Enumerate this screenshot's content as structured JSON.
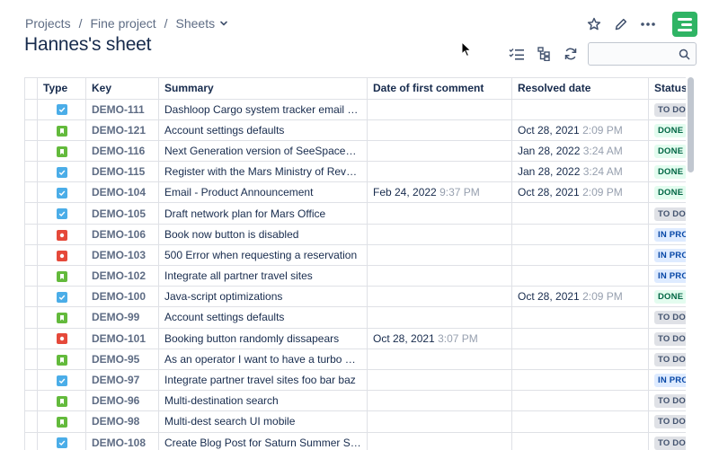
{
  "breadcrumb": {
    "items": [
      "Projects",
      "Fine project",
      "Sheets"
    ],
    "separator": "/"
  },
  "page": {
    "title": "Hannes's sheet"
  },
  "top_actions": [
    "star-icon",
    "pencil-icon",
    "more-icon",
    "app-logo"
  ],
  "toolbar": [
    "checklist-icon",
    "hierarchy-icon",
    "refresh-icon"
  ],
  "search": {
    "value": "",
    "placeholder": ""
  },
  "table": {
    "columns": [
      "Type",
      "Key",
      "Summary",
      "Date of first comment",
      "Resolved date",
      "Status"
    ],
    "rows": [
      {
        "type": "task",
        "key": "DEMO-111",
        "summary": "Dashloop Cargo system tracker email setup",
        "comment_date": "",
        "comment_time": "",
        "resolved_date": "",
        "resolved_time": "",
        "status": "TO DO"
      },
      {
        "type": "story",
        "key": "DEMO-121",
        "summary": "Account settings defaults",
        "comment_date": "",
        "comment_time": "",
        "resolved_date": "Oct 28, 2021",
        "resolved_time": "2:09 PM",
        "status": "DONE"
      },
      {
        "type": "story",
        "key": "DEMO-116",
        "summary": "Next Generation version of SeeSpaceEZ t…",
        "comment_date": "",
        "comment_time": "",
        "resolved_date": "Jan 28, 2022",
        "resolved_time": "3:24 AM",
        "status": "DONE"
      },
      {
        "type": "task",
        "key": "DEMO-115",
        "summary": "Register with the Mars Ministry of Revenue",
        "comment_date": "",
        "comment_time": "",
        "resolved_date": "Jan 28, 2022",
        "resolved_time": "3:24 AM",
        "status": "DONE"
      },
      {
        "type": "task",
        "key": "DEMO-104",
        "summary": "Email - Product Announcement",
        "comment_date": "Feb 24, 2022",
        "comment_time": "9:37 PM",
        "resolved_date": "Oct 28, 2021",
        "resolved_time": "2:09 PM",
        "status": "DONE"
      },
      {
        "type": "task",
        "key": "DEMO-105",
        "summary": "Draft network plan for Mars Office",
        "comment_date": "",
        "comment_time": "",
        "resolved_date": "",
        "resolved_time": "",
        "status": "TO DO"
      },
      {
        "type": "bug",
        "key": "DEMO-106",
        "summary": "Book now button is disabled",
        "comment_date": "",
        "comment_time": "",
        "resolved_date": "",
        "resolved_time": "",
        "status": "IN PRO"
      },
      {
        "type": "bug",
        "key": "DEMO-103",
        "summary": "500 Error when requesting a reservation",
        "comment_date": "",
        "comment_time": "",
        "resolved_date": "",
        "resolved_time": "",
        "status": "IN PRO"
      },
      {
        "type": "story",
        "key": "DEMO-102",
        "summary": "Integrate all partner travel sites",
        "comment_date": "",
        "comment_time": "",
        "resolved_date": "",
        "resolved_time": "",
        "status": "IN PRO"
      },
      {
        "type": "task",
        "key": "DEMO-100",
        "summary": "Java-script optimizations",
        "comment_date": "",
        "comment_time": "",
        "resolved_date": "Oct 28, 2021",
        "resolved_time": "2:09 PM",
        "status": "DONE"
      },
      {
        "type": "story",
        "key": "DEMO-99",
        "summary": "Account settings defaults",
        "comment_date": "",
        "comment_time": "",
        "resolved_date": "",
        "resolved_time": "",
        "status": "TO DO"
      },
      {
        "type": "bug",
        "key": "DEMO-101",
        "summary": "Booking button randomly dissapears",
        "comment_date": "Oct 28, 2021",
        "comment_time": "3:07 PM",
        "resolved_date": "",
        "resolved_time": "",
        "status": "TO DO"
      },
      {
        "type": "story",
        "key": "DEMO-95",
        "summary": "As an operator I want to have a turbo butt…",
        "comment_date": "",
        "comment_time": "",
        "resolved_date": "",
        "resolved_time": "",
        "status": "TO DO"
      },
      {
        "type": "task",
        "key": "DEMO-97",
        "summary": "Integrate partner travel sites foo bar baz",
        "comment_date": "",
        "comment_time": "",
        "resolved_date": "",
        "resolved_time": "",
        "status": "IN PRO"
      },
      {
        "type": "story",
        "key": "DEMO-96",
        "summary": "Multi-destination search",
        "comment_date": "",
        "comment_time": "",
        "resolved_date": "",
        "resolved_time": "",
        "status": "TO DO"
      },
      {
        "type": "story",
        "key": "DEMO-98",
        "summary": "Multi-dest search UI mobile",
        "comment_date": "",
        "comment_time": "",
        "resolved_date": "",
        "resolved_time": "",
        "status": "TO DO"
      },
      {
        "type": "task",
        "key": "DEMO-108",
        "summary": "Create Blog Post for Saturn Summer Sale",
        "comment_date": "",
        "comment_time": "",
        "resolved_date": "",
        "resolved_time": "",
        "status": "TO DO"
      }
    ]
  },
  "colors": {
    "task": "#4bade8",
    "story": "#63ba3c",
    "bug": "#e5493a",
    "brand": "#2fb464"
  }
}
